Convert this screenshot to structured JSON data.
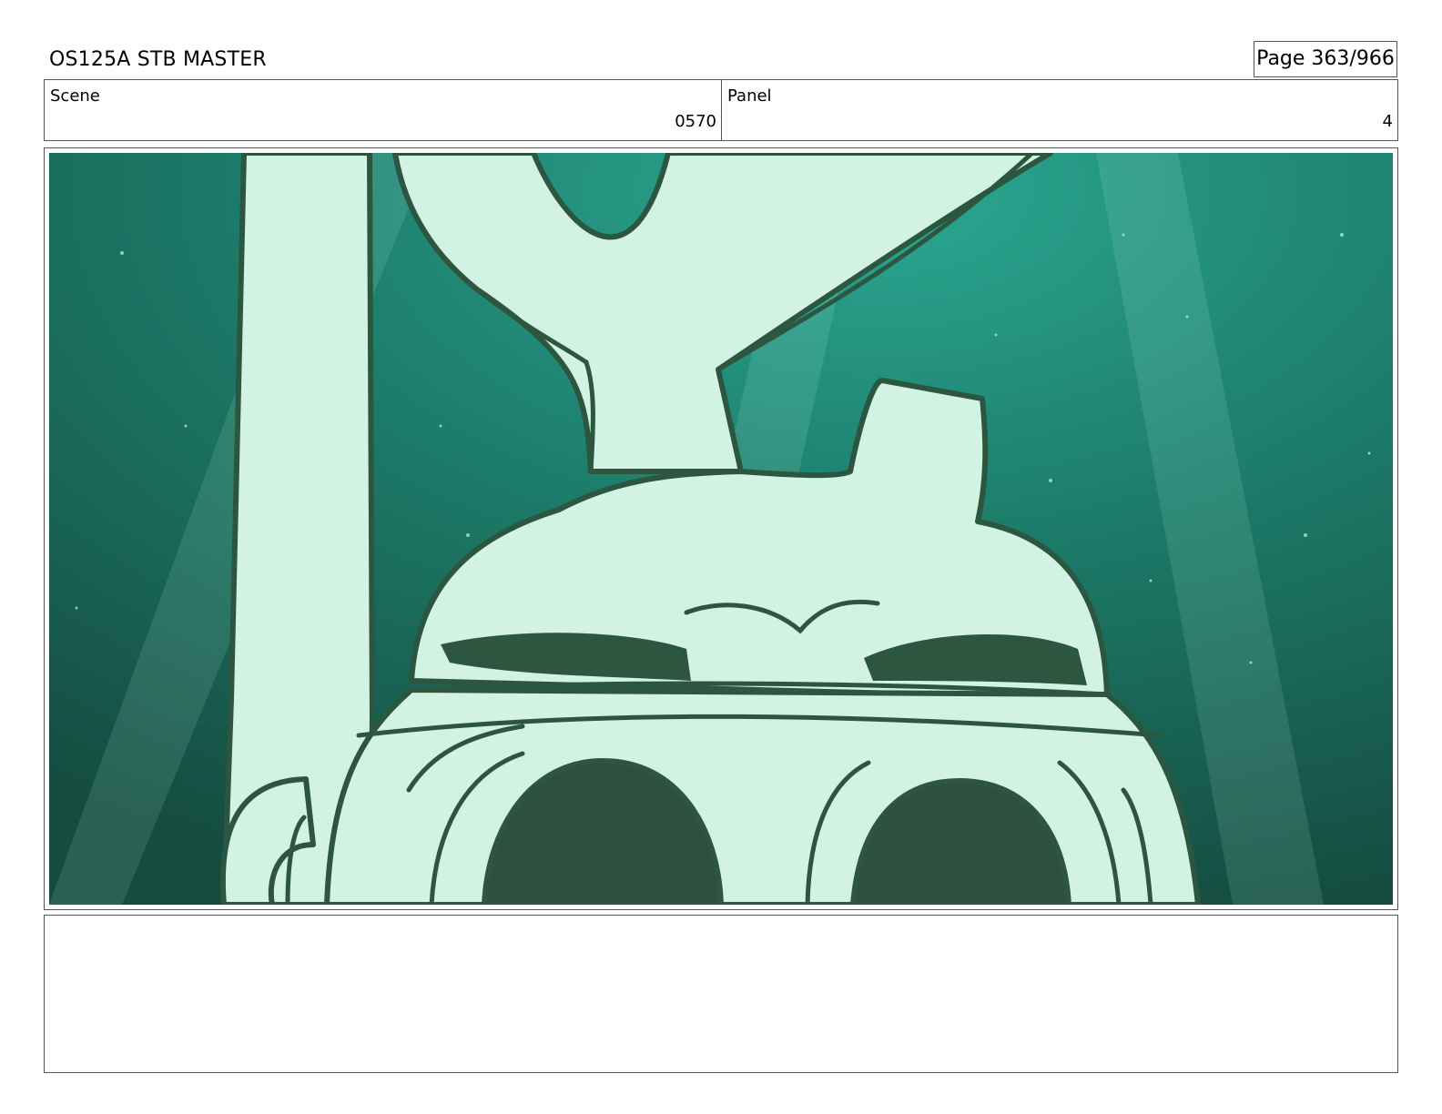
{
  "header": {
    "title": "OS125A  STB MASTER",
    "page": "Page 363/966"
  },
  "info": {
    "scene_label": "Scene",
    "scene_value": "0570",
    "panel_label": "Panel",
    "panel_value": "4"
  },
  "panel_image": {
    "description_icon": "storyboard-drawing",
    "colors": {
      "water_light": "#2aa892",
      "water_dark": "#154c40",
      "fill": "#d2f3e4",
      "ink": "#2d5641"
    }
  },
  "notes": {
    "text": ""
  }
}
